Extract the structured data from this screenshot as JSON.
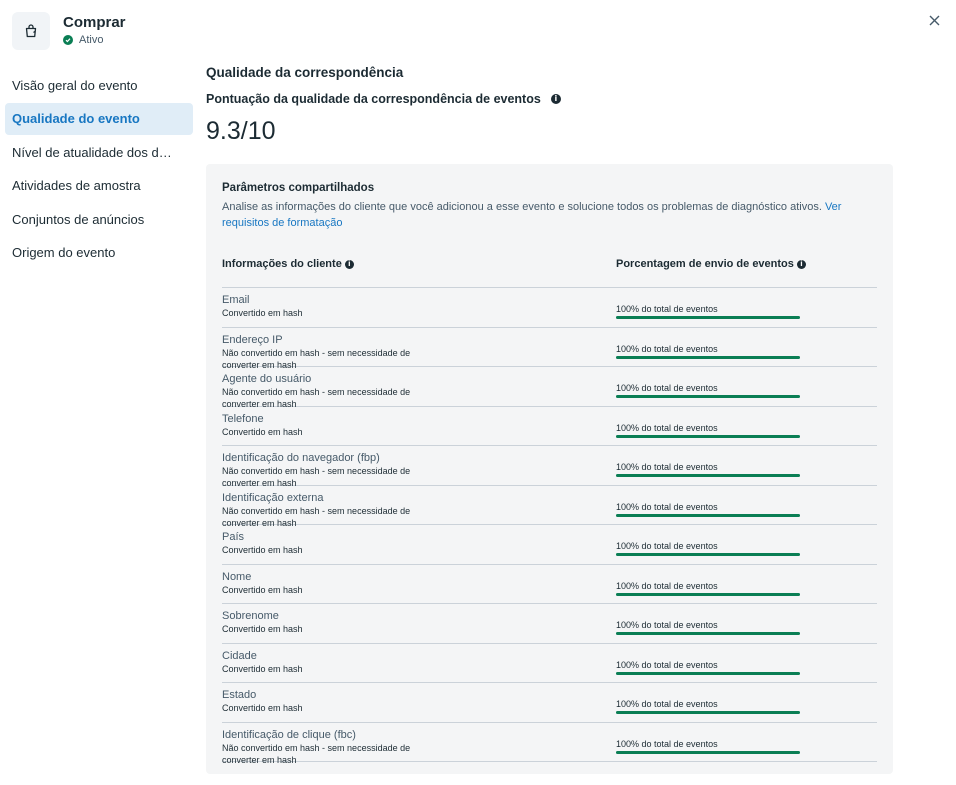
{
  "header": {
    "event_name": "Comprar",
    "status": "Ativo",
    "status_color": "#0a7e54"
  },
  "sidebar": {
    "items": [
      {
        "label": "Visão geral do evento",
        "active": false
      },
      {
        "label": "Qualidade do evento",
        "active": true
      },
      {
        "label": "Nível de atualidade dos d…",
        "active": false
      },
      {
        "label": "Atividades de amostra",
        "active": false
      },
      {
        "label": "Conjuntos de anúncios",
        "active": false
      },
      {
        "label": "Origem do evento",
        "active": false
      }
    ]
  },
  "main": {
    "section_title": "Qualidade da correspondência",
    "score_label": "Pontuação da qualidade da correspondência de eventos",
    "score_value": "9.3/10",
    "panel": {
      "title": "Parâmetros compartilhados",
      "description": "Analise as informações do cliente que você adicionou a esse evento e solucione todos os problemas de diagnóstico ativos.",
      "link_text": "Ver requisitos de formatação"
    },
    "table": {
      "col1_header": "Informações do cliente",
      "col2_header": "Porcentagem de envio de eventos",
      "rows": [
        {
          "name": "Email",
          "sub": "Convertido em hash",
          "pct_text": "100% do total de eventos",
          "pct": 1.0
        },
        {
          "name": "Endereço IP",
          "sub": "Não convertido em hash - sem necessidade de converter em hash",
          "pct_text": "100% do total de eventos",
          "pct": 1.0
        },
        {
          "name": "Agente do usuário",
          "sub": "Não convertido em hash - sem necessidade de converter em hash",
          "pct_text": "100% do total de eventos",
          "pct": 1.0
        },
        {
          "name": "Telefone",
          "sub": "Convertido em hash",
          "pct_text": "100% do total de eventos",
          "pct": 1.0
        },
        {
          "name": "Identificação do navegador (fbp)",
          "sub": "Não convertido em hash - sem necessidade de converter em hash",
          "pct_text": "100% do total de eventos",
          "pct": 1.0
        },
        {
          "name": "Identificação externa",
          "sub": "Não convertido em hash - sem necessidade de converter em hash",
          "pct_text": "100% do total de eventos",
          "pct": 1.0
        },
        {
          "name": "País",
          "sub": "Convertido em hash",
          "pct_text": "100% do total de eventos",
          "pct": 1.0
        },
        {
          "name": "Nome",
          "sub": "Convertido em hash",
          "pct_text": "100% do total de eventos",
          "pct": 1.0
        },
        {
          "name": "Sobrenome",
          "sub": "Convertido em hash",
          "pct_text": "100% do total de eventos",
          "pct": 1.0
        },
        {
          "name": "Cidade",
          "sub": "Convertido em hash",
          "pct_text": "100% do total de eventos",
          "pct": 1.0
        },
        {
          "name": "Estado",
          "sub": "Convertido em hash",
          "pct_text": "100% do total de eventos",
          "pct": 1.0
        },
        {
          "name": "Identificação de clique (fbc)",
          "sub": "Não convertido em hash - sem necessidade de converter em hash",
          "pct_text": "100% do total de eventos",
          "pct": 1.0
        }
      ]
    }
  }
}
